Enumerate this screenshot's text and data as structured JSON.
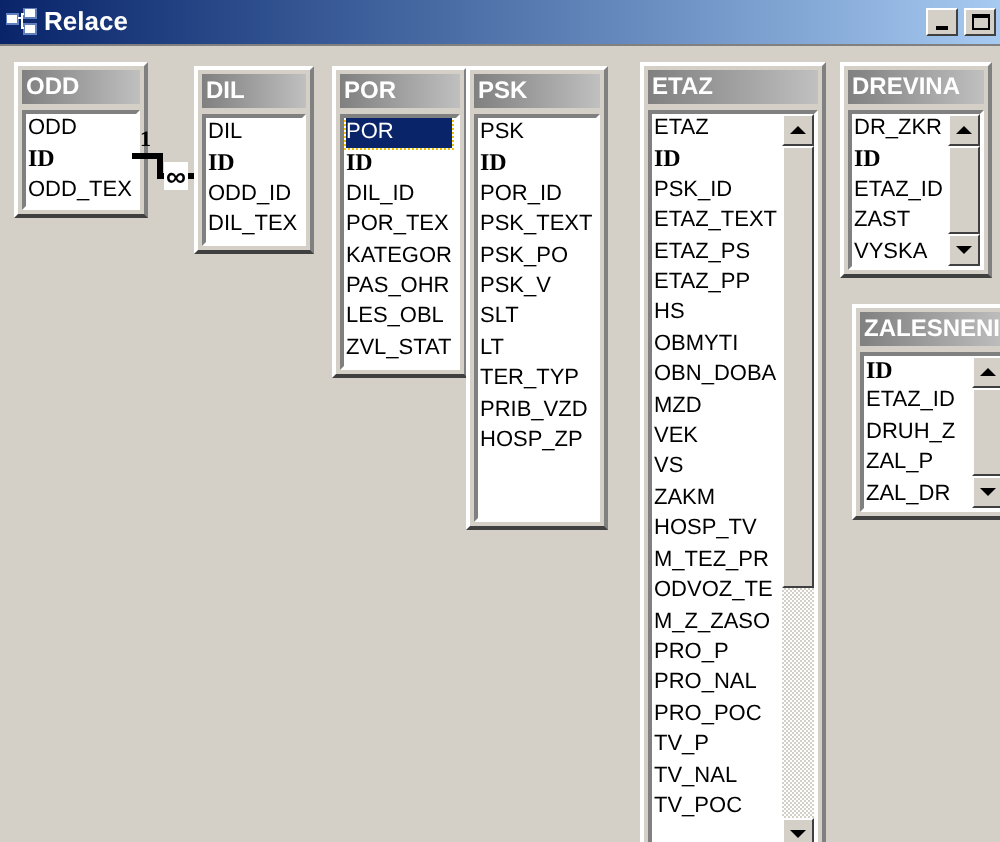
{
  "window": {
    "title": "Relace"
  },
  "tables": [
    {
      "name": "ODD",
      "items": [
        {
          "label": "ODD",
          "kind": "field",
          "selected": false
        },
        {
          "label": "ID",
          "kind": "key",
          "selected": false
        },
        {
          "label": "ODD_TEX",
          "kind": "field",
          "selected": false
        }
      ]
    },
    {
      "name": "DIL",
      "items": [
        {
          "label": "DIL",
          "kind": "field",
          "selected": false
        },
        {
          "label": "ID",
          "kind": "key",
          "selected": false
        },
        {
          "label": "ODD_ID",
          "kind": "field",
          "selected": false
        },
        {
          "label": "DIL_TEX",
          "kind": "field",
          "selected": false
        }
      ]
    },
    {
      "name": "POR",
      "items": [
        {
          "label": "POR",
          "kind": "field",
          "selected": true
        },
        {
          "label": "ID",
          "kind": "key",
          "selected": false
        },
        {
          "label": "DIL_ID",
          "kind": "field",
          "selected": false
        },
        {
          "label": "POR_TEX",
          "kind": "field",
          "selected": false
        },
        {
          "label": "KATEGOR",
          "kind": "field",
          "selected": false
        },
        {
          "label": "PAS_OHR",
          "kind": "field",
          "selected": false
        },
        {
          "label": "LES_OBL",
          "kind": "field",
          "selected": false
        },
        {
          "label": "ZVL_STAT",
          "kind": "field",
          "selected": false
        }
      ]
    },
    {
      "name": "PSK",
      "items": [
        {
          "label": "PSK",
          "kind": "field",
          "selected": false
        },
        {
          "label": "ID",
          "kind": "key",
          "selected": false
        },
        {
          "label": "POR_ID",
          "kind": "field",
          "selected": false
        },
        {
          "label": "PSK_TEXT",
          "kind": "field",
          "selected": false
        },
        {
          "label": "PSK_PO",
          "kind": "field",
          "selected": false
        },
        {
          "label": "PSK_V",
          "kind": "field",
          "selected": false
        },
        {
          "label": "SLT",
          "kind": "field",
          "selected": false
        },
        {
          "label": "LT",
          "kind": "field",
          "selected": false
        },
        {
          "label": "TER_TYP",
          "kind": "field",
          "selected": false
        },
        {
          "label": "PRIB_VZD",
          "kind": "field",
          "selected": false
        },
        {
          "label": "HOSP_ZP",
          "kind": "field",
          "selected": false
        }
      ]
    },
    {
      "name": "ETAZ",
      "items": [
        {
          "label": "ETAZ",
          "kind": "field",
          "selected": false
        },
        {
          "label": "ID",
          "kind": "key",
          "selected": false
        },
        {
          "label": "PSK_ID",
          "kind": "field",
          "selected": false
        },
        {
          "label": "ETAZ_TEXT",
          "kind": "field",
          "selected": false
        },
        {
          "label": "ETAZ_PS",
          "kind": "field",
          "selected": false
        },
        {
          "label": "ETAZ_PP",
          "kind": "field",
          "selected": false
        },
        {
          "label": "HS",
          "kind": "field",
          "selected": false
        },
        {
          "label": "OBMYTI",
          "kind": "field",
          "selected": false
        },
        {
          "label": "OBN_DOBA",
          "kind": "field",
          "selected": false
        },
        {
          "label": "MZD",
          "kind": "field",
          "selected": false
        },
        {
          "label": "VEK",
          "kind": "field",
          "selected": false
        },
        {
          "label": "VS",
          "kind": "field",
          "selected": false
        },
        {
          "label": "ZAKM",
          "kind": "field",
          "selected": false
        },
        {
          "label": "HOSP_TV",
          "kind": "field",
          "selected": false
        },
        {
          "label": "M_TEZ_PR",
          "kind": "field",
          "selected": false
        },
        {
          "label": "ODVOZ_TE",
          "kind": "field",
          "selected": false
        },
        {
          "label": "M_Z_ZASO",
          "kind": "field",
          "selected": false
        },
        {
          "label": "PRO_P",
          "kind": "field",
          "selected": false
        },
        {
          "label": "PRO_NAL",
          "kind": "field",
          "selected": false
        },
        {
          "label": "PRO_POC",
          "kind": "field",
          "selected": false
        },
        {
          "label": "TV_P",
          "kind": "field",
          "selected": false
        },
        {
          "label": "TV_NAL",
          "kind": "field",
          "selected": false
        },
        {
          "label": "TV_POC",
          "kind": "field",
          "selected": false
        }
      ]
    },
    {
      "name": "DREVINA",
      "items": [
        {
          "label": "DR_ZKR",
          "kind": "field",
          "selected": false
        },
        {
          "label": "ID",
          "kind": "key",
          "selected": false
        },
        {
          "label": "ETAZ_ID",
          "kind": "field",
          "selected": false
        },
        {
          "label": "ZAST",
          "kind": "field",
          "selected": false
        },
        {
          "label": "VYSKA",
          "kind": "field",
          "selected": false
        }
      ]
    },
    {
      "name": "ZALESNENI",
      "items": [
        {
          "label": "ID",
          "kind": "key",
          "selected": false
        },
        {
          "label": "ETAZ_ID",
          "kind": "field",
          "selected": false
        },
        {
          "label": "DRUH_Z",
          "kind": "field",
          "selected": false
        },
        {
          "label": "ZAL_P",
          "kind": "field",
          "selected": false
        },
        {
          "label": "ZAL_DR",
          "kind": "field",
          "selected": false
        }
      ]
    }
  ],
  "relationship": {
    "from_label": "1",
    "to_label": "∞"
  }
}
